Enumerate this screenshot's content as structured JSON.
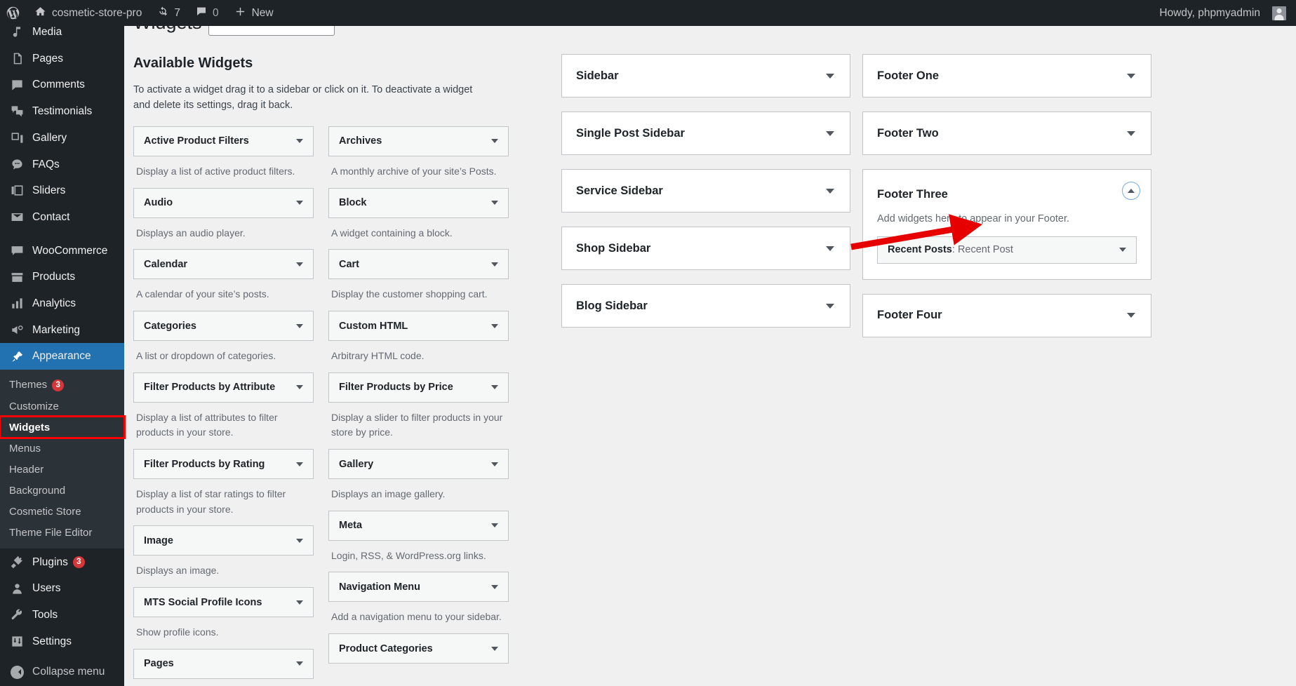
{
  "adminbar": {
    "logo_icon": "wordpress-logo-icon",
    "site_icon": "home-icon",
    "site_name": "cosmetic-store-pro",
    "updates_icon": "updates-icon",
    "updates_count": "7",
    "comments_icon": "comment-bubble-icon",
    "comments_count": "0",
    "new_icon": "plus-icon",
    "new_label": "New",
    "howdy": "Howdy, phpmyadmin",
    "avatar_icon": "avatar-icon"
  },
  "sidebar": {
    "items": [
      {
        "label": "Media",
        "icon": "media-icon"
      },
      {
        "label": "Pages",
        "icon": "pages-icon"
      },
      {
        "label": "Comments",
        "icon": "comments-icon"
      },
      {
        "label": "Testimonials",
        "icon": "testimonials-icon"
      },
      {
        "label": "Gallery",
        "icon": "gallery-icon"
      },
      {
        "label": "FAQs",
        "icon": "faqs-icon"
      },
      {
        "label": "Sliders",
        "icon": "sliders-icon"
      },
      {
        "label": "Contact",
        "icon": "contact-icon"
      }
    ],
    "items2": [
      {
        "label": "WooCommerce",
        "icon": "woocommerce-icon"
      },
      {
        "label": "Products",
        "icon": "products-icon"
      },
      {
        "label": "Analytics",
        "icon": "analytics-icon"
      },
      {
        "label": "Marketing",
        "icon": "marketing-icon"
      }
    ],
    "appearance": {
      "label": "Appearance",
      "icon": "appearance-icon"
    },
    "appearance_submenu": [
      {
        "label": "Themes",
        "badge": "3"
      },
      {
        "label": "Customize",
        "badge": ""
      },
      {
        "label": "Widgets",
        "badge": ""
      },
      {
        "label": "Menus",
        "badge": ""
      },
      {
        "label": "Header",
        "badge": ""
      },
      {
        "label": "Background",
        "badge": ""
      },
      {
        "label": "Cosmetic Store",
        "badge": ""
      },
      {
        "label": "Theme File Editor",
        "badge": ""
      }
    ],
    "items3": [
      {
        "label": "Plugins",
        "icon": "plugins-icon",
        "badge": "3"
      },
      {
        "label": "Users",
        "icon": "users-icon",
        "badge": ""
      },
      {
        "label": "Tools",
        "icon": "tools-icon",
        "badge": ""
      },
      {
        "label": "Settings",
        "icon": "settings-icon",
        "badge": ""
      }
    ],
    "collapse": {
      "label": "Collapse menu",
      "icon": "collapse-menu-icon"
    }
  },
  "page": {
    "title": "Widgets",
    "search_placeholder": "",
    "search_value": ""
  },
  "available": {
    "heading": "Available Widgets",
    "intro": "To activate a widget drag it to a sidebar or click on it. To deactivate a widget and delete its settings, drag it back.",
    "left_column": [
      {
        "title": "Active Product Filters",
        "desc": "Display a list of active product filters."
      },
      {
        "title": "Audio",
        "desc": "Displays an audio player."
      },
      {
        "title": "Calendar",
        "desc": "A calendar of your site’s posts."
      },
      {
        "title": "Categories",
        "desc": "A list or dropdown of categories."
      },
      {
        "title": "Filter Products by Attribute",
        "desc": "Display a list of attributes to filter products in your store."
      },
      {
        "title": "Filter Products by Rating",
        "desc": "Display a list of star ratings to filter products in your store."
      },
      {
        "title": "Image",
        "desc": "Displays an image."
      },
      {
        "title": "MTS Social Profile Icons",
        "desc": "Show profile icons."
      },
      {
        "title": "Pages",
        "desc": ""
      }
    ],
    "right_column": [
      {
        "title": "Archives",
        "desc": "A monthly archive of your site’s Posts."
      },
      {
        "title": "Block",
        "desc": "A widget containing a block."
      },
      {
        "title": "Cart",
        "desc": "Display the customer shopping cart."
      },
      {
        "title": "Custom HTML",
        "desc": "Arbitrary HTML code."
      },
      {
        "title": "Filter Products by Price",
        "desc": "Display a slider to filter products in your store by price."
      },
      {
        "title": "Gallery",
        "desc": "Displays an image gallery."
      },
      {
        "title": "Meta",
        "desc": "Login, RSS, & WordPress.org links."
      },
      {
        "title": "Navigation Menu",
        "desc": "Add a navigation menu to your sidebar."
      },
      {
        "title": "Product Categories",
        "desc": ""
      }
    ]
  },
  "sidebars_column1": [
    {
      "name": "Sidebar",
      "open": false,
      "hint": "",
      "widgets": []
    },
    {
      "name": "Single Post Sidebar",
      "open": false,
      "hint": "",
      "widgets": []
    },
    {
      "name": "Service Sidebar",
      "open": false,
      "hint": "",
      "widgets": []
    },
    {
      "name": "Shop Sidebar",
      "open": false,
      "hint": "",
      "widgets": []
    },
    {
      "name": "Blog Sidebar",
      "open": false,
      "hint": "",
      "widgets": []
    }
  ],
  "sidebars_column2": [
    {
      "name": "Footer One",
      "open": false,
      "hint": "",
      "widgets": []
    },
    {
      "name": "Footer Two",
      "open": false,
      "hint": "",
      "widgets": []
    },
    {
      "name": "Footer Three",
      "open": true,
      "hint": "Add widgets here to appear in your Footer.",
      "toggle_icon": "chevron-up-icon",
      "widgets": [
        {
          "type": "Recent Posts",
          "title": "Recent Post"
        }
      ]
    },
    {
      "name": "Footer Four",
      "open": false,
      "hint": "",
      "widgets": []
    }
  ],
  "annotation": {
    "arrow_color": "#e60000",
    "highlight_color": "#ff0000",
    "highlight_target": "Widgets",
    "arrow_points_to": "Recent Posts: Recent Post"
  }
}
